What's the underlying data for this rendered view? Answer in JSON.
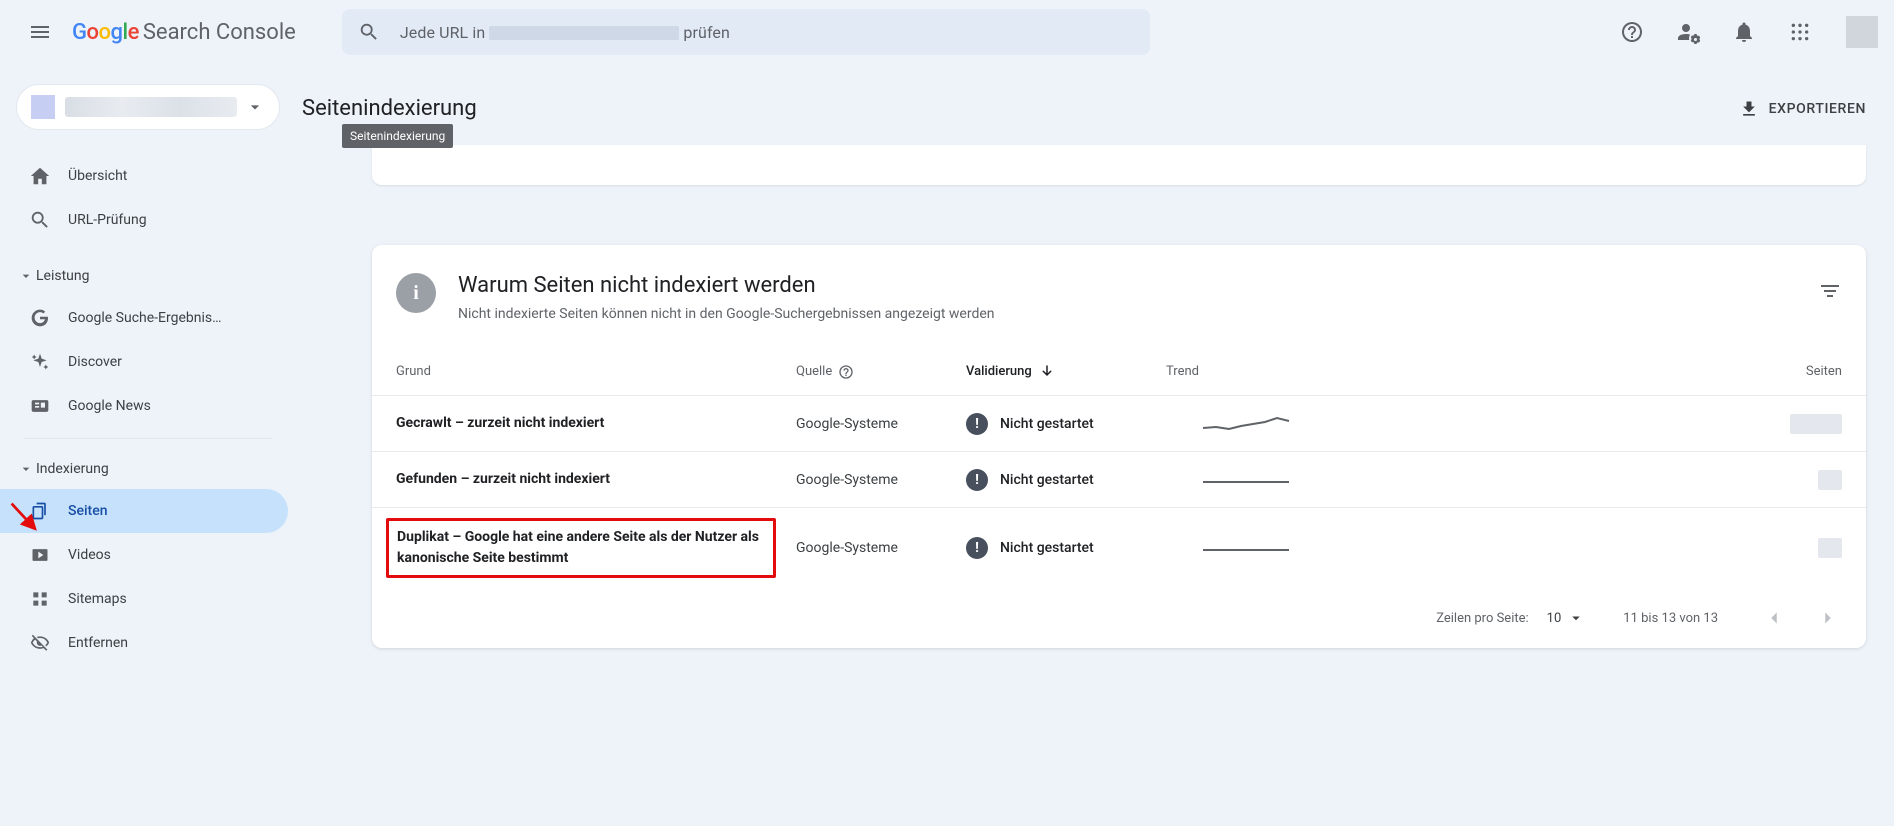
{
  "header": {
    "product_name": "Search Console",
    "search_prefix": "Jede URL in ",
    "search_suffix": " prüfen"
  },
  "page": {
    "title": "Seitenindexierung",
    "tooltip": "Seitenindexierung",
    "export_label": "EXPORTIEREN"
  },
  "sidebar": {
    "items": {
      "overview": "Übersicht",
      "url_inspection": "URL-Prüfung"
    },
    "groups": {
      "performance": {
        "label": "Leistung",
        "search": "Google Suche-Ergebnis…",
        "discover": "Discover",
        "news": "Google News"
      },
      "indexing": {
        "label": "Indexierung",
        "pages": "Seiten",
        "videos": "Videos",
        "sitemaps": "Sitemaps",
        "removals": "Entfernen"
      }
    }
  },
  "reasons": {
    "title": "Warum Seiten nicht indexiert werden",
    "subtitle": "Nicht indexierte Seiten können nicht in den Google-Suchergebnissen angezeigt werden",
    "columns": {
      "reason": "Grund",
      "source": "Quelle",
      "validation": "Validierung",
      "trend": "Trend",
      "pages": "Seiten"
    },
    "rows": [
      {
        "reason": "Gecrawlt – zurzeit nicht indexiert",
        "source": "Google-Systeme",
        "validation": "Nicht gestartet"
      },
      {
        "reason": "Gefunden – zurzeit nicht indexiert",
        "source": "Google-Systeme",
        "validation": "Nicht gestartet"
      },
      {
        "reason": "Duplikat – Google hat eine andere Seite als der Nutzer als kanonische Seite bestimmt",
        "source": "Google-Systeme",
        "validation": "Nicht gestartet"
      }
    ],
    "footer": {
      "rows_per_page_label": "Zeilen pro Seite:",
      "rows_per_page_value": "10",
      "range": "11 bis 13 von 13"
    }
  }
}
